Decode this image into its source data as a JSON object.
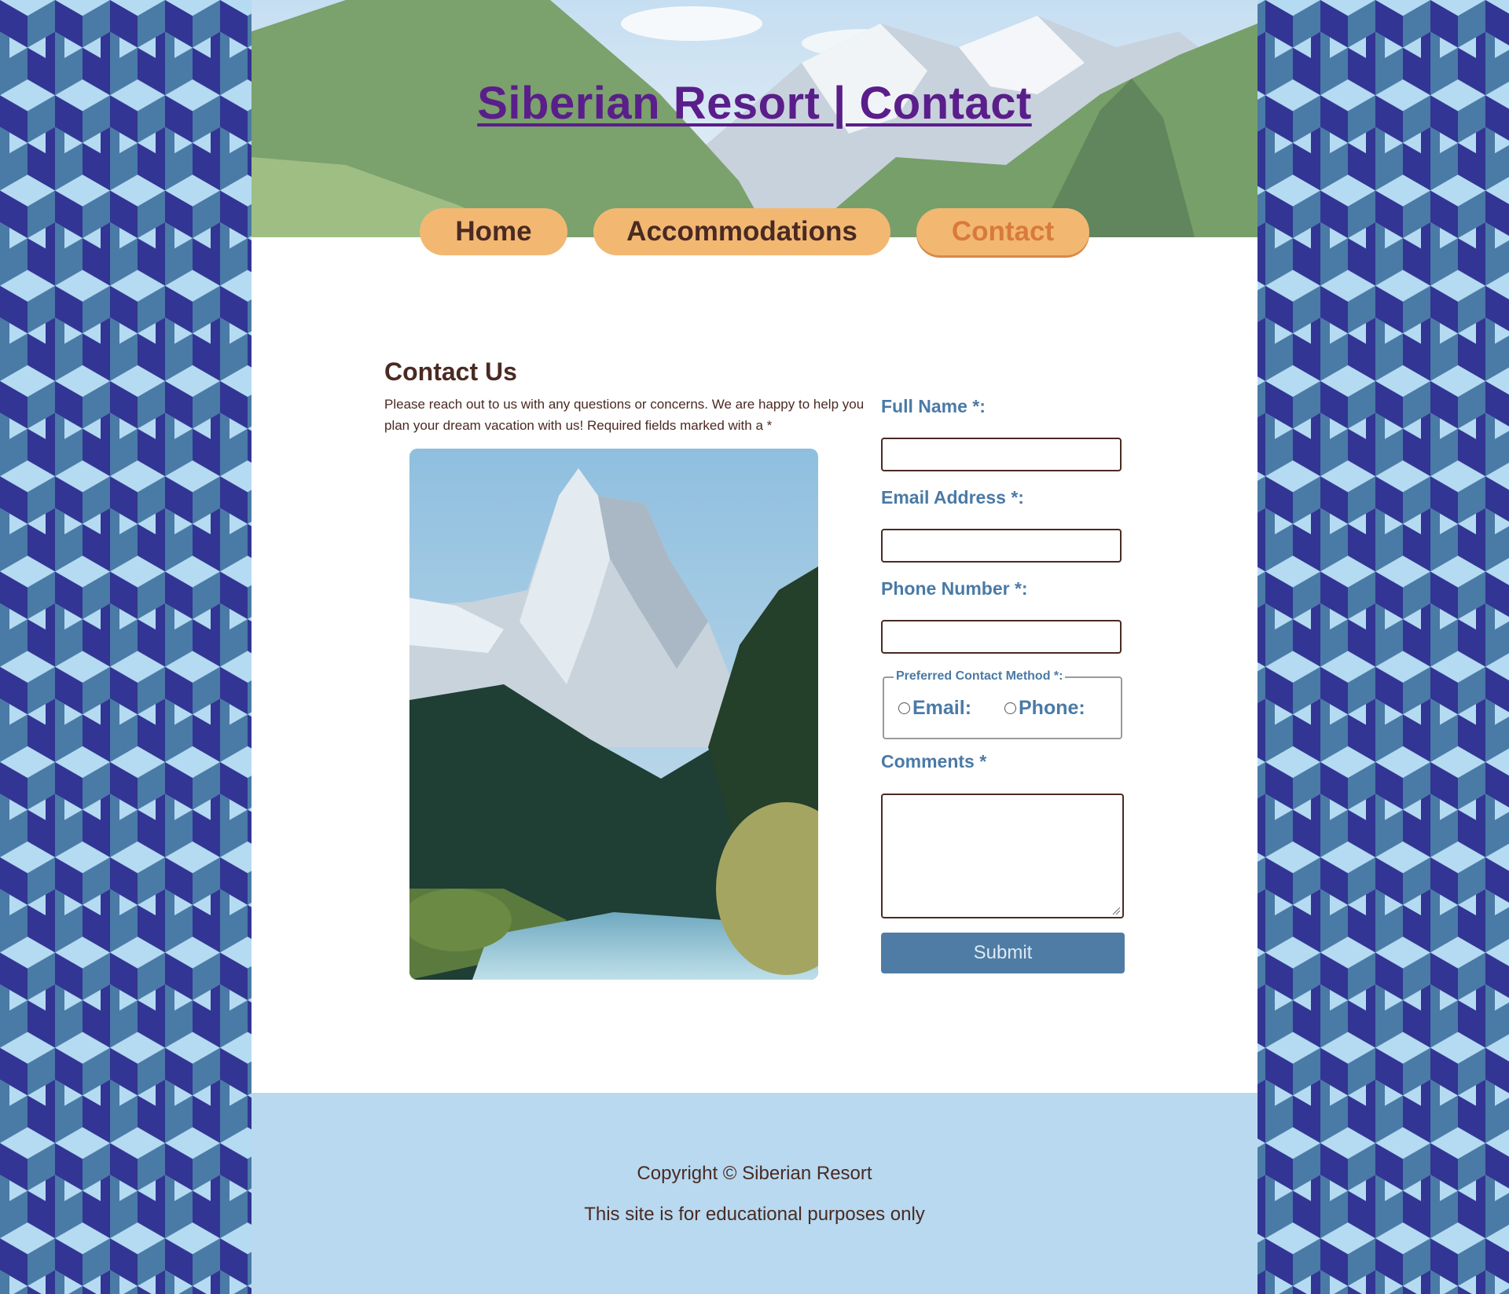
{
  "colors": {
    "pattern_dark": "#323593",
    "pattern_mid": "#4a7aa6",
    "pattern_light": "#b5dbf2",
    "nav_bg": "#f2b872",
    "nav_text": "#4a2a22",
    "nav_active_text": "#d97a3a",
    "title": "#5a1e8a",
    "label": "#4a7aa6",
    "body_text": "#4a2a22",
    "submit_bg": "#4f7ca4",
    "footer_bg": "#b8d9f0"
  },
  "header": {
    "title": "Siberian Resort | Contact"
  },
  "nav": {
    "items": [
      {
        "label": "Home"
      },
      {
        "label": "Accommodations"
      },
      {
        "label": "Contact"
      }
    ],
    "active": "Contact"
  },
  "main": {
    "heading": "Contact Us",
    "intro": "Please reach out to us with any questions or concerns. We are happy to help you plan your dream vacation with us! Required fields marked with a *"
  },
  "form": {
    "full_name_label": "Full Name *:",
    "email_label": "Email Address *:",
    "phone_label": "Phone Number *:",
    "contact_method_legend": "Preferred Contact Method *:",
    "radio_email": "Email:",
    "radio_phone": "Phone:",
    "comments_label": "Comments *",
    "submit_label": "Submit"
  },
  "footer": {
    "copyright": "Copyright © Siberian Resort",
    "disclaimer": "This site is for educational purposes only"
  }
}
